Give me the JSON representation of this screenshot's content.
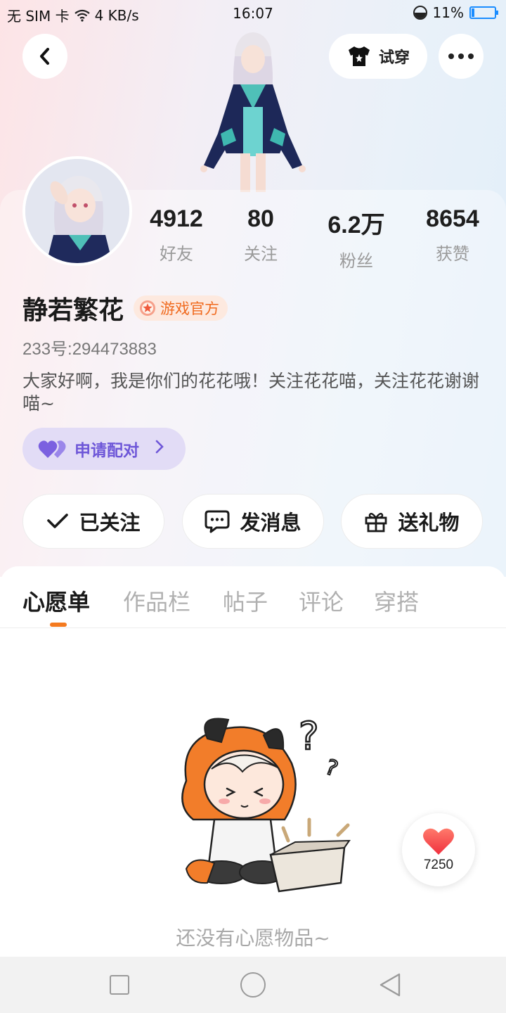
{
  "status_bar": {
    "carrier": "无 SIM 卡",
    "speed": "4 KB/s",
    "time": "16:07",
    "battery": "11%"
  },
  "header": {
    "try_on_label": "试穿"
  },
  "profile": {
    "name": "静若繁花",
    "badge": "游戏官方",
    "uid": "233号:294473883",
    "bio": "大家好啊，我是你们的花花哦！关注花花喵，关注花花谢谢喵~",
    "stats": [
      {
        "value": "4912",
        "label": "好友"
      },
      {
        "value": "80",
        "label": "关注"
      },
      {
        "value": "6.2万",
        "label": "粉丝"
      },
      {
        "value": "8654",
        "label": "获赞"
      }
    ],
    "match_label": "申请配对"
  },
  "actions": {
    "followed": "已关注",
    "message": "发消息",
    "gift": "送礼物"
  },
  "tabs": [
    "心愿单",
    "作品栏",
    "帖子",
    "评论",
    "穿搭"
  ],
  "empty_state": {
    "text": "还没有心愿物品~"
  },
  "likes": {
    "count": "7250"
  },
  "colors": {
    "accent": "#f47a1f",
    "match": "#6e57d8",
    "badge": "#f06a1e"
  }
}
